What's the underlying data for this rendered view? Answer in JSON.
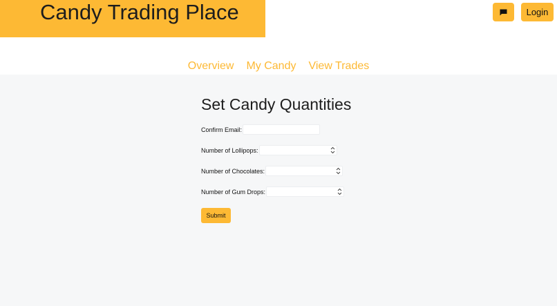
{
  "header": {
    "brand_title": "Candy Trading Place",
    "chat_icon": "chat-bubble-icon",
    "login_label": "Login"
  },
  "nav": {
    "items": [
      {
        "label": "Overview"
      },
      {
        "label": "My Candy"
      },
      {
        "label": "View Trades"
      }
    ]
  },
  "form": {
    "title": "Set Candy Quantities",
    "email_label": "Confirm Email:",
    "email_value": "",
    "lollipops_label": "Number of Lollipops:",
    "lollipops_value": "",
    "chocolates_label": "Number of Chocolates:",
    "chocolates_value": "",
    "gumdrops_label": "Number of Gum Drops:",
    "gumdrops_value": "",
    "submit_label": "Submit"
  },
  "colors": {
    "accent": "#fdb934",
    "page_background": "#f6f7f8",
    "text": "#1d1d1d"
  }
}
